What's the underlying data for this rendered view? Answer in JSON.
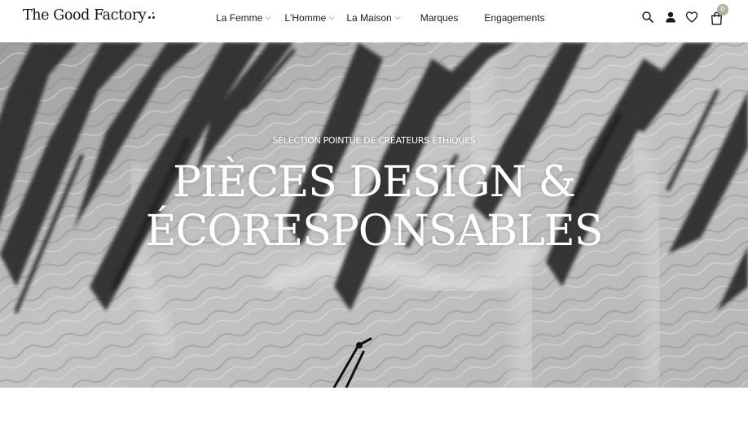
{
  "header": {
    "logo_text": "The Good Factory",
    "logo_dots_icon": "dots-mark-icon"
  },
  "nav": {
    "items": [
      {
        "label": "La Femme",
        "has_dropdown": true
      },
      {
        "label": "L'Homme",
        "has_dropdown": true
      },
      {
        "label": "La Maison",
        "has_dropdown": true
      },
      {
        "label": "Marques",
        "has_dropdown": false
      },
      {
        "label": "Engagements",
        "has_dropdown": false
      }
    ]
  },
  "icons": {
    "search": "search-icon",
    "account": "user-icon",
    "wishlist": "heart-icon",
    "cart": "shopping-bag-icon"
  },
  "cart": {
    "count": "0",
    "badge_color": "#a9b39a"
  },
  "hero": {
    "kicker": "SÉLECTION POINTUE DE CRÉATEURS ÉTHIQUES",
    "title_line1": "PIÈCES DESIGN &",
    "title_line2": "ÉCORESPONSABLES",
    "image": "black-and-white sand with palm shadows"
  }
}
